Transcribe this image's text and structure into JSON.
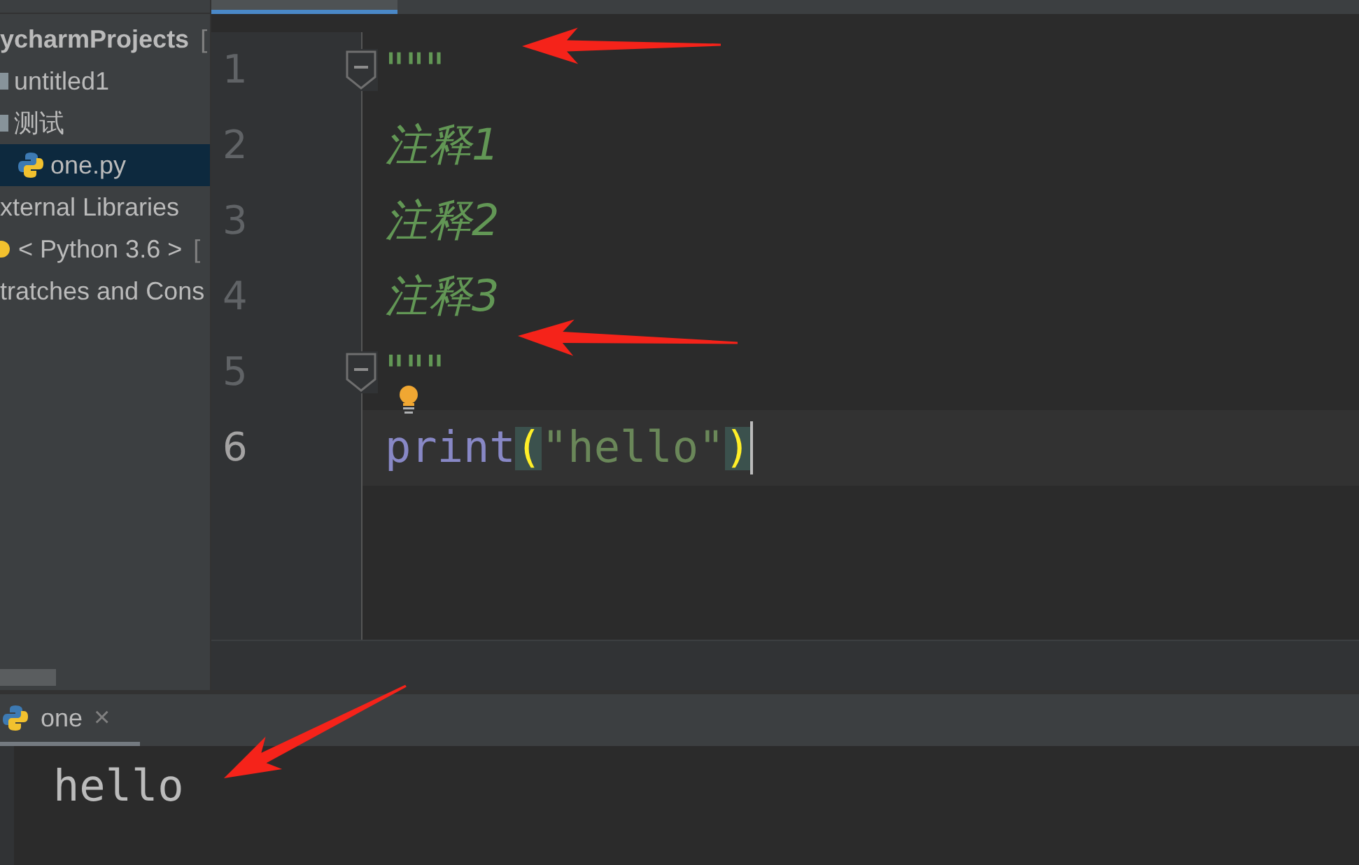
{
  "project_tree": {
    "items": [
      {
        "label": "ycharmProjects",
        "kind": "root",
        "suffix": "[",
        "selected": false
      },
      {
        "label": "untitled1",
        "kind": "folder",
        "selected": false
      },
      {
        "label": "测试",
        "kind": "folder",
        "selected": false
      },
      {
        "label": "one.py",
        "kind": "python_file",
        "selected": true
      },
      {
        "label": "xternal Libraries",
        "kind": "plain",
        "selected": false
      },
      {
        "label": "< Python 3.6 >",
        "kind": "sdk",
        "suffix": "[",
        "selected": false
      },
      {
        "label": "tratches and Cons",
        "kind": "plain",
        "selected": false
      }
    ]
  },
  "editor": {
    "lines": [
      {
        "number": "1",
        "fold": true,
        "current": false,
        "tokens": [
          {
            "text": "\"\"\"",
            "kind": "docstring"
          }
        ]
      },
      {
        "number": "2",
        "fold": false,
        "current": false,
        "tokens": [
          {
            "text": "注释1",
            "kind": "docstring"
          }
        ]
      },
      {
        "number": "3",
        "fold": false,
        "current": false,
        "tokens": [
          {
            "text": "注释2",
            "kind": "docstring"
          }
        ]
      },
      {
        "number": "4",
        "fold": false,
        "current": false,
        "tokens": [
          {
            "text": "注释3",
            "kind": "docstring"
          }
        ]
      },
      {
        "number": "5",
        "fold": true,
        "current": false,
        "tokens": [
          {
            "text": "\"\"\"",
            "kind": "docstring"
          }
        ]
      },
      {
        "number": "6",
        "fold": false,
        "current": true,
        "tokens": [
          {
            "text": "print",
            "kind": "builtin"
          },
          {
            "text": "(",
            "kind": "paren"
          },
          {
            "text": "\"hello\"",
            "kind": "string"
          },
          {
            "text": ")",
            "kind": "paren"
          }
        ]
      }
    ]
  },
  "run_panel": {
    "tab": {
      "label": "one",
      "close": "×",
      "selected": true
    },
    "output": "hello"
  }
}
